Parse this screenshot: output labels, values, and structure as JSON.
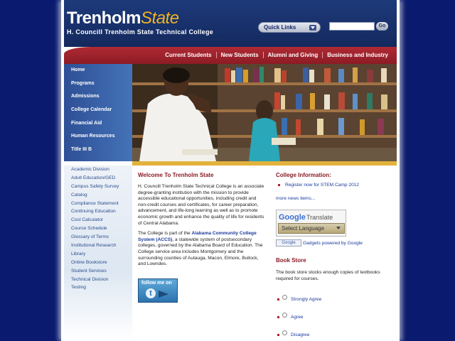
{
  "header": {
    "logo_main": "Trenholm",
    "logo_accent": "State",
    "subtitle": "H. Councill Trenholm State Technical College",
    "quick_links": "Quick Links",
    "go_label": "Go"
  },
  "top_nav": [
    "Current Students",
    "New Students",
    "Alumni and Giving",
    "Business and Industry"
  ],
  "side_nav": [
    "Home",
    "Programs",
    "Admissions",
    "College Calendar",
    "Financial Aid",
    "Human Resources",
    "Title III B"
  ],
  "left_links": [
    "Academic Division",
    "Adult Education/GED",
    "Campus Safety Survey",
    "Catalog",
    "Compliance Statement",
    "Continuing Education",
    "Cost Calculator",
    "Course Schedule",
    "Glossary of Terms",
    "Institutional Research",
    "Library",
    "Online Bookstore",
    "Student Services",
    "Technical Division",
    "Testing"
  ],
  "welcome": {
    "title": "Welcome To Trenholm State",
    "para1": "H. Councill Trenholm State Technical College is an associate degree-granting institution with the mission to provide accessible educational opportunities, including credit and non-credit courses and certificates, for career preparation, advancement, and life-long learning as well as to promote economic growth and enhance the quality of life for residents of Central Alabama.",
    "para2_a": "The College is part of the ",
    "para2_link": "Alabama Community College System (ACCS)",
    "para2_b": ", a statewide system of postsecondary colleges, governed by the Alabama Board of Education. The College service area includes Montgomery and the surrounding counties of Autauga, Macon, Elmore, Bullock, and Lowndes.",
    "follow_text": "follow me on",
    "follow_glyph": "t"
  },
  "college_info": {
    "title": "College Information:",
    "news_item": "Register now for STEM Camp 2012",
    "more_news": "more news items..."
  },
  "translate": {
    "google": "Google",
    "translate_word": "Translate",
    "select_language": "Select Language",
    "gadget_badge": "Google",
    "gadgets_text": "Gadgets powered by Google"
  },
  "bookstore": {
    "title": "Book Store",
    "question": "The book store stocks enough copies of textbooks required for courses.",
    "options": [
      "Strongly Agree",
      "Agree",
      "Disagree"
    ]
  },
  "colors": {
    "background": "#0a1a6e",
    "header": "#1d3a7a",
    "red_bar": "#b02a34",
    "gold": "#e2b23c",
    "heading_red": "#8a1b24",
    "link_blue": "#1a3a9c"
  }
}
